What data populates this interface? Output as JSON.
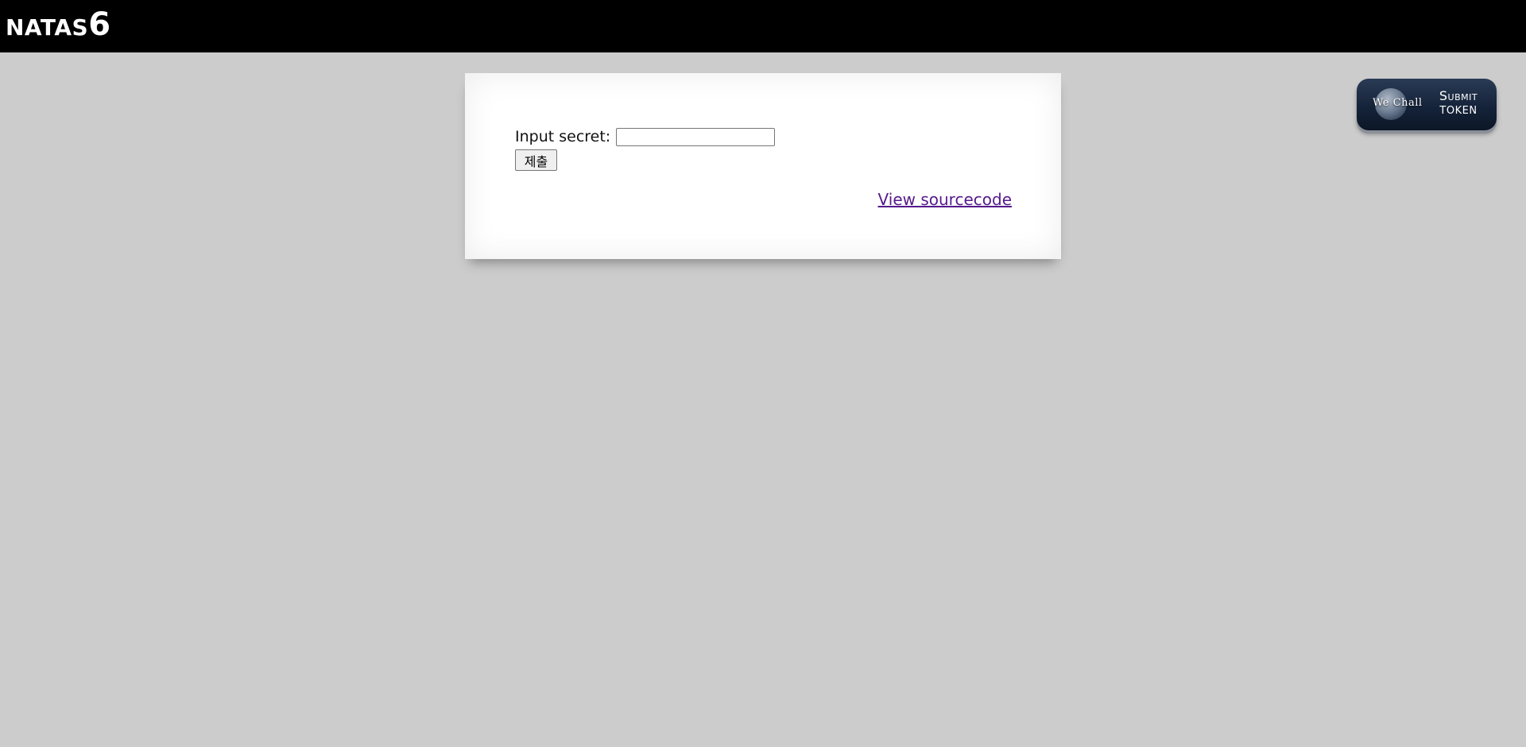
{
  "header": {
    "title_main": "NATAS",
    "title_number": "6"
  },
  "card": {
    "secret_label": "Input secret:",
    "secret_value": "",
    "submit_label": "제출",
    "source_link": "View sourcecode"
  },
  "token_badge": {
    "brand": "We Chall",
    "line1": "Submit",
    "line2": "TOKEN"
  },
  "colors": {
    "header_bg": "#000000",
    "page_bg": "#cccccc",
    "link_visited": "#551a8b",
    "badge_bg": "#15233a"
  }
}
